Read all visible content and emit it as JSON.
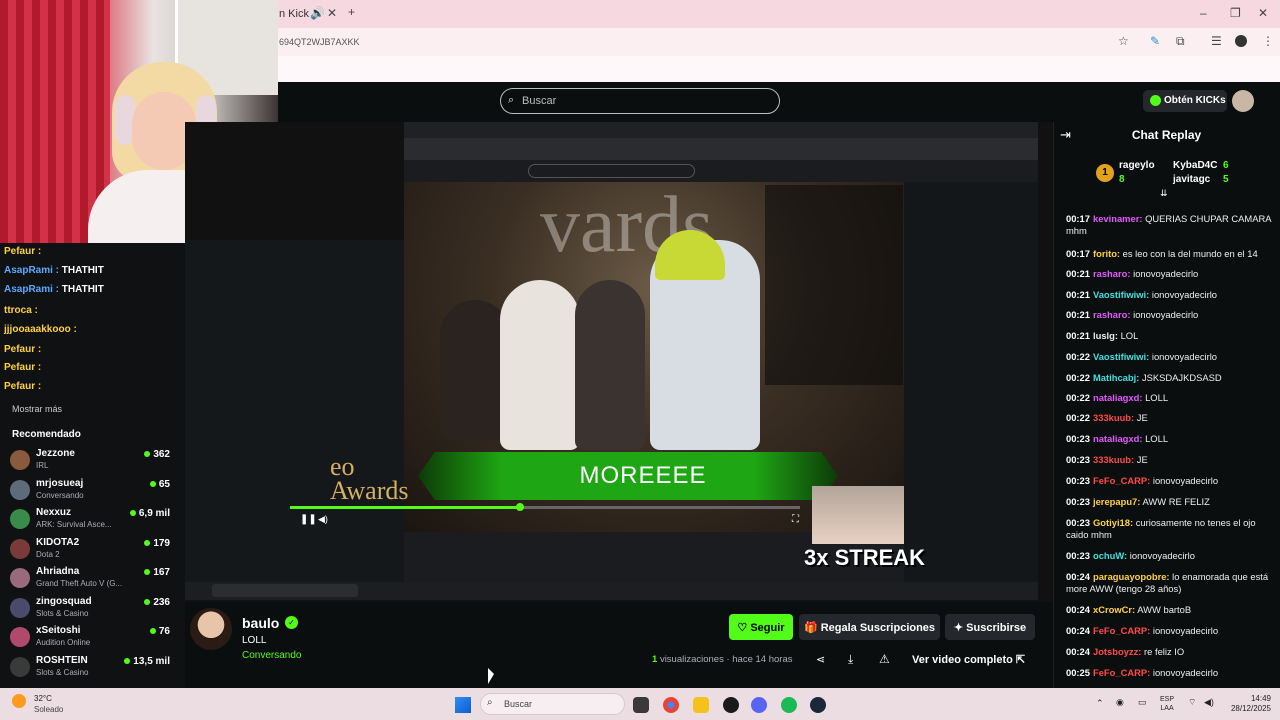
{
  "browser": {
    "tab_title": "n Kick",
    "url": "694QT2WJB7AXKK"
  },
  "overlay_chat": [
    {
      "name": "Pefaur :",
      "msg": "",
      "color": "yellow"
    },
    {
      "name": "AsapRami :",
      "msg": "THATHIT",
      "color": "blue"
    },
    {
      "name": "AsapRami :",
      "msg": "THATHIT",
      "color": "blue"
    },
    {
      "name": "ttroca :",
      "msg": "",
      "color": "yellow"
    },
    {
      "name": "jjjooaaakkooo :",
      "msg": "",
      "color": "yellow"
    },
    {
      "name": "Pefaur :",
      "msg": "",
      "color": "yellow"
    },
    {
      "name": "Pefaur :",
      "msg": "",
      "color": "yellow"
    },
    {
      "name": "Pefaur :",
      "msg": "",
      "color": "yellow"
    }
  ],
  "sidebar": {
    "show_more": "Mostrar más",
    "recommended_title": "Recomendado",
    "recommended": [
      {
        "name": "Jezzone",
        "category": "IRL",
        "viewers": "362",
        "color": "#8a5a3c"
      },
      {
        "name": "mrjosueaj",
        "category": "Conversando",
        "viewers": "65",
        "color": "#5d6b7a"
      },
      {
        "name": "Nexxuz",
        "category": "ARK: Survival Asce...",
        "viewers": "6,9 mil",
        "color": "#3a8a4a"
      },
      {
        "name": "KIDOTA2",
        "category": "Dota 2",
        "viewers": "179",
        "color": "#7a3a3a"
      },
      {
        "name": "Ahriadna",
        "category": "Grand Theft Auto V (G...",
        "viewers": "167",
        "color": "#9a6a7a"
      },
      {
        "name": "zingosquad",
        "category": "Slots & Casino",
        "viewers": "236",
        "color": "#4a4a6a"
      },
      {
        "name": "xSeitoshi",
        "category": "Audition Online",
        "viewers": "76",
        "color": "#b04a6a"
      },
      {
        "name": "ROSHTEIN",
        "category": "Slots & Casino",
        "viewers": "13,5 mil",
        "color": "#3a3a3a"
      }
    ]
  },
  "header": {
    "search_placeholder": "Buscar",
    "kicks_label": "Obtén KICKs"
  },
  "video": {
    "banner_text": "MOREEEE",
    "awards_text": "eo\nAwards",
    "streak_text": "3x STREAK",
    "stage_text": "vards",
    "progress": 0.45
  },
  "chat": {
    "title": "Chat Replay",
    "leaderboard": [
      {
        "name": "rageylo",
        "value": "8"
      },
      {
        "name": "KybaD4C",
        "value": "6"
      },
      {
        "name": "javitagc",
        "value": "5"
      }
    ],
    "messages": [
      {
        "time": "00:17",
        "user": "kevinamer:",
        "text": "QUERIAS CHUPAR CAMARA mhm",
        "color": "#e05aff"
      },
      {
        "time": "00:17",
        "user": "forito:",
        "text": "es leo con la del mundo en el 14",
        "color": "#ffd23f"
      },
      {
        "time": "00:21",
        "user": "rasharo:",
        "text": "ionovoyadecirlo",
        "color": "#e05aff"
      },
      {
        "time": "00:21",
        "user": "Vaostifiwiwi:",
        "text": "ionovoyadecirlo",
        "color": "#3ee0e0"
      },
      {
        "time": "00:21",
        "user": "rasharo:",
        "text": "ionovoyadecirlo",
        "color": "#e05aff"
      },
      {
        "time": "00:21",
        "user": "luslg:",
        "text": "LOL",
        "color": "#efeff1"
      },
      {
        "time": "00:22",
        "user": "Vaostifiwiwi:",
        "text": "ionovoyadecirlo",
        "color": "#3ee0e0"
      },
      {
        "time": "00:22",
        "user": "Matihcabj:",
        "text": "JSKSDAJKDSASD",
        "color": "#3ee0e0"
      },
      {
        "time": "00:22",
        "user": "nataliagxd:",
        "text": "LOLL",
        "color": "#e05aff"
      },
      {
        "time": "00:22",
        "user": "333kuub:",
        "text": "JE",
        "color": "#ff4a4a"
      },
      {
        "time": "00:23",
        "user": "nataliagxd:",
        "text": "LOLL",
        "color": "#e05aff"
      },
      {
        "time": "00:23",
        "user": "333kuub:",
        "text": "JE",
        "color": "#ff4a4a"
      },
      {
        "time": "00:23",
        "user": "FeFo_CARP:",
        "text": "ionovoyadecirlo",
        "color": "#ff4a4a"
      },
      {
        "time": "00:23",
        "user": "jerepapu7:",
        "text": "AWW RE FELIZ",
        "color": "#ffd23f"
      },
      {
        "time": "00:23",
        "user": "Gotiyi18:",
        "text": "curiosamente no tenes el ojo caido mhm",
        "color": "#ffd23f"
      },
      {
        "time": "00:23",
        "user": "ochuW:",
        "text": "ionovoyadecirlo",
        "color": "#3ee0e0"
      },
      {
        "time": "00:24",
        "user": "paraguayopobre:",
        "text": "lo enamorada que está more AWW (tengo 28 años)",
        "color": "#ffd23f"
      },
      {
        "time": "00:24",
        "user": "xCrowCr:",
        "text": "AWW bartoB",
        "color": "#ffd23f"
      },
      {
        "time": "00:24",
        "user": "FeFo_CARP:",
        "text": "ionovoyadecirlo",
        "color": "#ff4a4a"
      },
      {
        "time": "00:24",
        "user": "Jotsboyzz:",
        "text": "re feliz IO",
        "color": "#ff4a4a"
      },
      {
        "time": "00:25",
        "user": "FeFo_CARP:",
        "text": "ionovoyadecirlo",
        "color": "#ff4a4a"
      }
    ]
  },
  "channel": {
    "name": "baulo",
    "title": "LOLL",
    "category": "Conversando",
    "follow": "Seguir",
    "gift": "Regala Suscripciones",
    "subscribe": "Suscribirse",
    "views_count": "1",
    "views_text": "visualizaciones · hace 14 horas",
    "full_video": "Ver video completo"
  },
  "taskbar": {
    "temp": "32°C",
    "weather": "Soleado",
    "search": "Buscar",
    "lang1": "ESP",
    "lang2": "LAA",
    "time": "14:49",
    "date": "28/12/2025"
  },
  "colors": {
    "accent": "#53fc18",
    "background": "#0b0e0f"
  }
}
